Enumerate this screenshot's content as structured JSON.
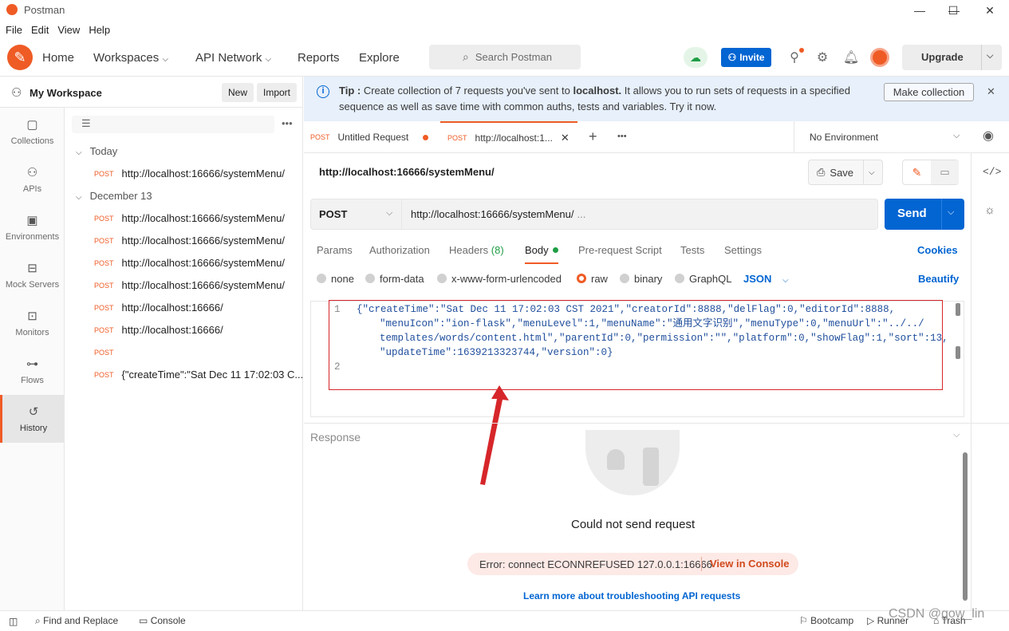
{
  "window": {
    "title": "Postman",
    "minimize": "—",
    "maximize": "☐",
    "close": "✕"
  },
  "menu": [
    "File",
    "Edit",
    "View",
    "Help"
  ],
  "header": {
    "home": "Home",
    "workspaces": "Workspaces",
    "api_network": "API Network",
    "reports": "Reports",
    "explore": "Explore",
    "search_placeholder": "Search Postman",
    "invite": "Invite",
    "upgrade": "Upgrade"
  },
  "workspace": {
    "name": "My Workspace",
    "new": "New",
    "import": "Import"
  },
  "rail": [
    {
      "icon": "collections-icon",
      "label": "Collections",
      "glyph": "▢"
    },
    {
      "icon": "apis-icon",
      "label": "APIs",
      "glyph": "⚇"
    },
    {
      "icon": "environments-icon",
      "label": "Environments",
      "glyph": "▣"
    },
    {
      "icon": "mock-servers-icon",
      "label": "Mock Servers",
      "glyph": "⊟"
    },
    {
      "icon": "monitors-icon",
      "label": "Monitors",
      "glyph": "⊡"
    },
    {
      "icon": "flows-icon",
      "label": "Flows",
      "glyph": "⊶"
    },
    {
      "icon": "history-icon",
      "label": "History",
      "glyph": "↺"
    }
  ],
  "history": {
    "today_label": "Today",
    "today": [
      {
        "method": "POST",
        "url": "http://localhost:16666/systemMenu/"
      }
    ],
    "dec13_label": "December 13",
    "dec13": [
      {
        "method": "POST",
        "url": "http://localhost:16666/systemMenu/"
      },
      {
        "method": "POST",
        "url": "http://localhost:16666/systemMenu/"
      },
      {
        "method": "POST",
        "url": "http://localhost:16666/systemMenu/"
      },
      {
        "method": "POST",
        "url": "http://localhost:16666/systemMenu/"
      },
      {
        "method": "POST",
        "url": "http://localhost:16666/"
      },
      {
        "method": "POST",
        "url": "http://localhost:16666/"
      },
      {
        "method": "POST",
        "url": ""
      },
      {
        "method": "POST",
        "url": "{\"createTime\":\"Sat Dec 11 17:02:03 C..."
      }
    ]
  },
  "tip": {
    "prefix": "Tip :",
    "text1": " Create collection of 7 requests you've sent to ",
    "host": "localhost.",
    "text2": " It allows you to run sets of requests in a specified",
    "line2": "sequence as well as save time with common auths, tests and variables. Try it now.",
    "button": "Make collection"
  },
  "tabs": [
    {
      "method": "POST",
      "label": "Untitled Request"
    },
    {
      "method": "POST",
      "label": "http://localhost:1..."
    }
  ],
  "environment": "No Environment",
  "request": {
    "name": "http://localhost:16666/systemMenu/",
    "save": "Save",
    "method": "POST",
    "url": "http://localhost:16666/systemMenu/",
    "url_more": "...",
    "send": "Send"
  },
  "subtabs": {
    "params": "Params",
    "authorization": "Authorization",
    "headers": "Headers",
    "headers_count": "(8)",
    "body": "Body",
    "prerequest": "Pre-request Script",
    "tests": "Tests",
    "settings": "Settings",
    "cookies": "Cookies"
  },
  "body_types": {
    "none": "none",
    "form_data": "form-data",
    "urlencoded": "x-www-form-urlencoded",
    "raw": "raw",
    "binary": "binary",
    "graphql": "GraphQL",
    "json": "JSON",
    "beautify": "Beautify"
  },
  "editor": {
    "line1_no": "1",
    "line2_no": "2",
    "code_l1": "{\"createTime\":\"Sat Dec 11 17:02:03 CST 2021\",\"creatorId\":8888,\"delFlag\":0,\"editorId\":8888,",
    "code_l2": "\"menuIcon\":\"ion-flask\",\"menuLevel\":1,\"menuName\":\"通用文字识别\",\"menuType\":0,\"menuUrl\":\"../../",
    "code_l3": "templates/words/content.html\",\"parentId\":0,\"permission\":\"\",\"platform\":0,\"showFlag\":1,\"sort\":13,",
    "code_l4": "\"updateTime\":1639213323744,\"version\":0}"
  },
  "response": {
    "title": "Response",
    "message": "Could not send request",
    "error": "Error: connect ECONNREFUSED 127.0.0.1:16666",
    "console_link": "View in Console",
    "learn_more": "Learn more about troubleshooting API requests"
  },
  "statusbar": {
    "find_replace": "Find and Replace",
    "console": "Console",
    "bootcamp": "Bootcamp",
    "runner": "Runner",
    "trash": "Trash",
    "watermark": "CSDN @gow_lin"
  },
  "colors": {
    "accent": "#ef5b25",
    "primary": "#0265d2",
    "annotation": "#d6262a"
  }
}
